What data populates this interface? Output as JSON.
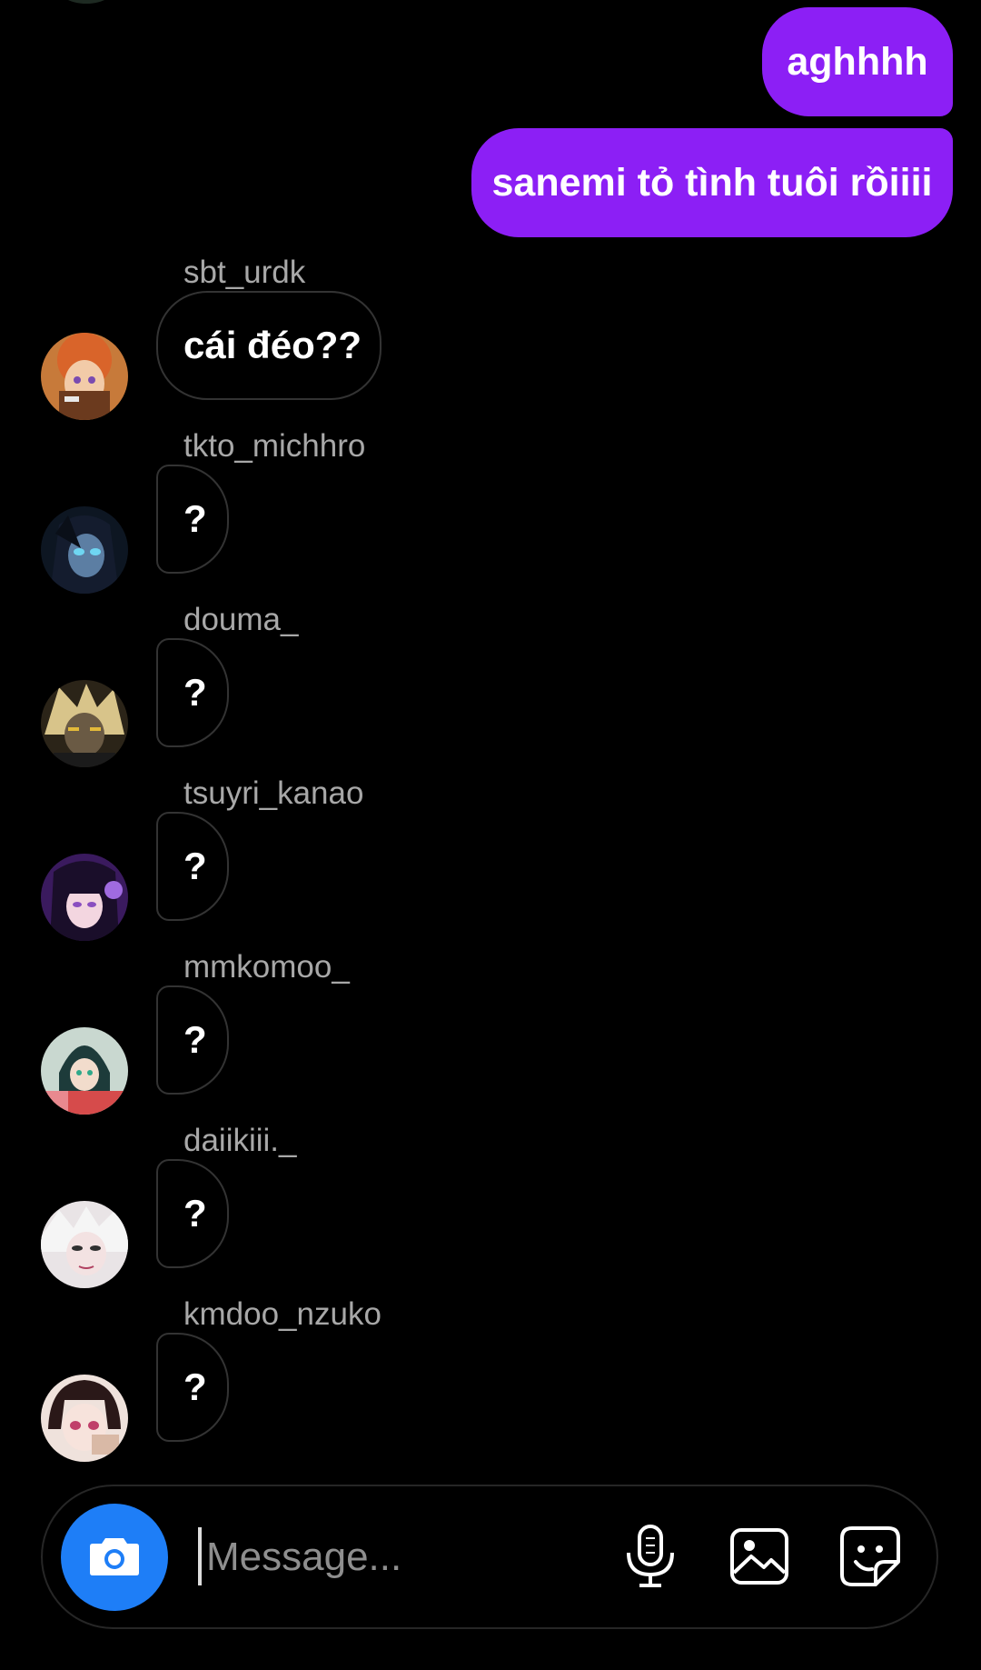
{
  "colors": {
    "background": "#000000",
    "sent_bubble": "#8c1ff5",
    "received_border": "#333333",
    "username_text": "#a8a8a8",
    "camera_button": "#1e7ef7",
    "placeholder": "#8e8e8e"
  },
  "sent_messages": [
    {
      "text": "aghhhh"
    },
    {
      "text": "sanemi tỏ tình tuôi rồiiii"
    }
  ],
  "received_messages": [
    {
      "username": "sbt_urdk",
      "text": "cái đéo??",
      "avatar": "avatar-orange-hair"
    },
    {
      "username": "tkto_michhro",
      "text": "?",
      "avatar": "avatar-dark-blue-eyes"
    },
    {
      "username": "douma_",
      "text": "?",
      "avatar": "avatar-blond-dark"
    },
    {
      "username": "tsuyri_kanao",
      "text": "?",
      "avatar": "avatar-purple-hair"
    },
    {
      "username": "mmkomoo_",
      "text": "?",
      "avatar": "avatar-teal-red"
    },
    {
      "username": "daiikiii._",
      "text": "?",
      "avatar": "avatar-white-hair"
    },
    {
      "username": "kmdoo_nzuko",
      "text": "?",
      "avatar": "avatar-pink-eyes"
    }
  ],
  "composer": {
    "placeholder": "Message...",
    "value": "",
    "icons": {
      "camera": "camera-icon",
      "mic": "microphone-icon",
      "gallery": "gallery-icon",
      "sticker": "sticker-icon"
    }
  }
}
